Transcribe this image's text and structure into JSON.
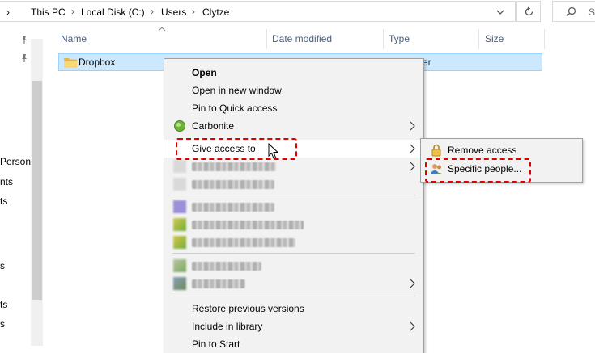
{
  "address_bar": {
    "crumbs": [
      "This PC",
      "Local Disk (C:)",
      "Users",
      "Clytze"
    ],
    "search_placeholder": "Se"
  },
  "nav_pane": {
    "items": [
      "Persona",
      "nts",
      "ts",
      "s",
      "ts",
      "s"
    ]
  },
  "columns": {
    "name": "Name",
    "date": "Date modified",
    "type": "Type",
    "size": "Size"
  },
  "file_row": {
    "name": "Dropbox",
    "type_partial": "er"
  },
  "context_menu": {
    "open": "Open",
    "open_new_window": "Open in new window",
    "pin_quick_access": "Pin to Quick access",
    "carbonite": "Carbonite",
    "give_access": "Give access to",
    "restore_versions": "Restore previous versions",
    "include_library": "Include in library",
    "pin_start": "Pin to Start"
  },
  "submenu": {
    "remove_access": "Remove access",
    "specific_people": "Specific people..."
  },
  "colors": {
    "selection_bg": "#cce8ff",
    "menu_bg": "#f2f2f2",
    "annotation": "#e00000"
  }
}
